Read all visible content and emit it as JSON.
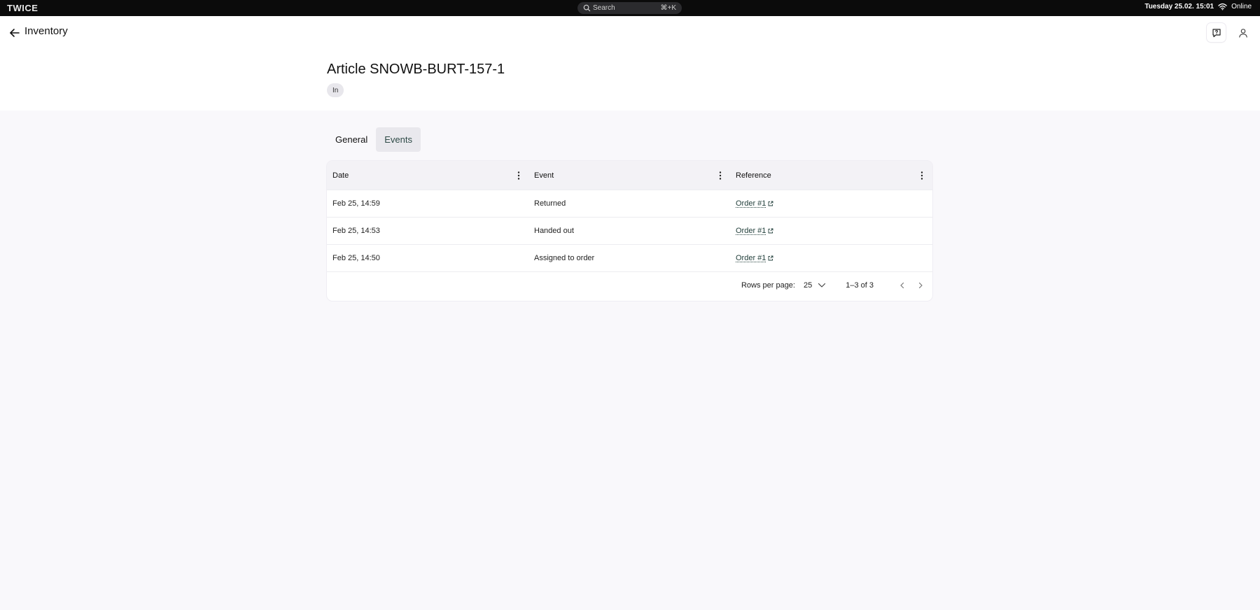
{
  "system": {
    "logo": "TWICE",
    "search_placeholder": "Search",
    "search_shortcut": "⌘+K",
    "datetime": "Tuesday 25.02. 15:01",
    "connection": "Online"
  },
  "header": {
    "title": "Inventory"
  },
  "article": {
    "title": "Article SNOWB-BURT-157-1",
    "status": "In"
  },
  "tabs": [
    {
      "label": "General",
      "active": false
    },
    {
      "label": "Events",
      "active": true
    }
  ],
  "table": {
    "columns": [
      "Date",
      "Event",
      "Reference"
    ],
    "rows": [
      {
        "date": "Feb 25, 14:59",
        "event": "Returned",
        "reference": "Order #1"
      },
      {
        "date": "Feb 25, 14:53",
        "event": "Handed out",
        "reference": "Order #1"
      },
      {
        "date": "Feb 25, 14:50",
        "event": "Assigned to order",
        "reference": "Order #1"
      }
    ],
    "footer": {
      "rows_per_page_label": "Rows per page:",
      "rows_per_page": "25",
      "page_info": "1–3 of 3"
    }
  },
  "icons": {
    "search": "search-icon",
    "wifi": "wifi-icon",
    "back": "arrow-left-icon",
    "help": "help-chat-icon",
    "user": "user-icon",
    "kebab": "kebab-menu-icon",
    "external": "external-link-icon",
    "chevron_down": "chevron-down-icon",
    "chevron_left": "chevron-left-icon",
    "chevron_right": "chevron-right-icon"
  },
  "colors": {
    "topbar": "#0b0b0b",
    "active_tab_bg": "#e9e8ed",
    "link": "#23403c",
    "page_bg": "#f9f8fb"
  }
}
